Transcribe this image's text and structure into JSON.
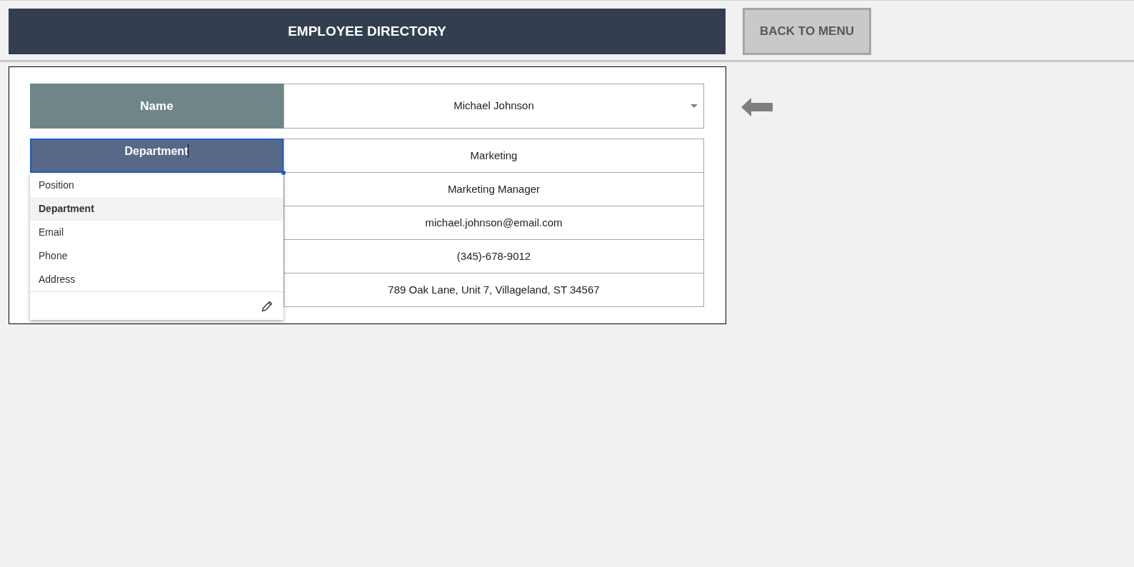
{
  "header": {
    "title": "EMPLOYEE DIRECTORY"
  },
  "back_button": {
    "label": "BACK TO MENU"
  },
  "lookup": {
    "label": "Name",
    "value": "Michael Johnson"
  },
  "details": {
    "rows": [
      {
        "label": "Department",
        "value": "Marketing"
      },
      {
        "value": "Marketing Manager"
      },
      {
        "value": "michael.johnson@email.com"
      },
      {
        "value": "(345)-678-9012"
      },
      {
        "value": "789 Oak Lane, Unit 7, Villageland, ST 34567"
      }
    ]
  },
  "label_dropdown": {
    "options": [
      {
        "label": "Position",
        "selected": false
      },
      {
        "label": "Department",
        "selected": true
      },
      {
        "label": "Email",
        "selected": false
      },
      {
        "label": "Phone",
        "selected": false
      },
      {
        "label": "Address",
        "selected": false
      }
    ]
  }
}
